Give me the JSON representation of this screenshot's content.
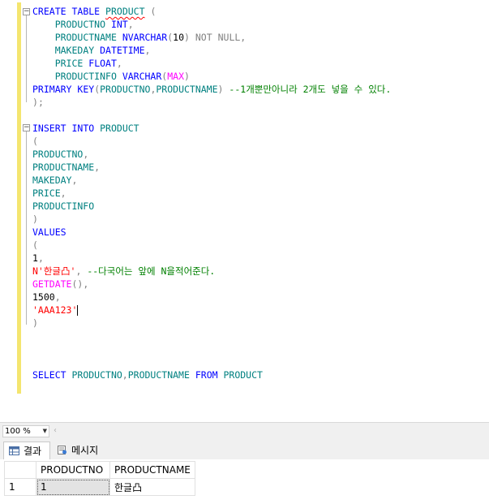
{
  "editor": {
    "lines": [
      "CREATE TABLE PRODUCT (",
      "    PRODUCTNO INT,",
      "    PRODUCTNAME NVARCHAR(10) NOT NULL,",
      "    MAKEDAY DATETIME,",
      "    PRICE FLOAT,",
      "    PRODUCTINFO VARCHAR(MAX)",
      "PRIMARY KEY(PRODUCTNO,PRODUCTNAME) --1개뿐만아니라 2개도 넣을 수 있다.",
      ");",
      "",
      "INSERT INTO PRODUCT",
      "(",
      "PRODUCTNO,",
      "PRODUCTNAME,",
      "MAKEDAY,",
      "PRICE,",
      "PRODUCTINFO",
      ")",
      "VALUES",
      "(",
      "1,",
      "N'한글凸', --다국어는 앞에 N을적어준다.",
      "GETDATE(),",
      "1500,",
      "'AAA123'",
      ")",
      "",
      "",
      "",
      "SELECT PRODUCTNO,PRODUCTNAME FROM PRODUCT"
    ]
  },
  "status": {
    "zoom": "100 %"
  },
  "tabs": {
    "results": "결과",
    "messages": "메시지"
  },
  "results": {
    "columns": [
      "PRODUCTNO",
      "PRODUCTNAME"
    ],
    "rows": [
      {
        "rownum": "1",
        "PRODUCTNO": "1",
        "PRODUCTNAME": "한글凸"
      }
    ]
  },
  "colors": {
    "keyword": "#0000ff",
    "object": "#008080",
    "operator": "#808080",
    "string": "#ff0000",
    "function": "#ff00ff",
    "comment": "#008000",
    "gutter": "#f4e56f"
  }
}
